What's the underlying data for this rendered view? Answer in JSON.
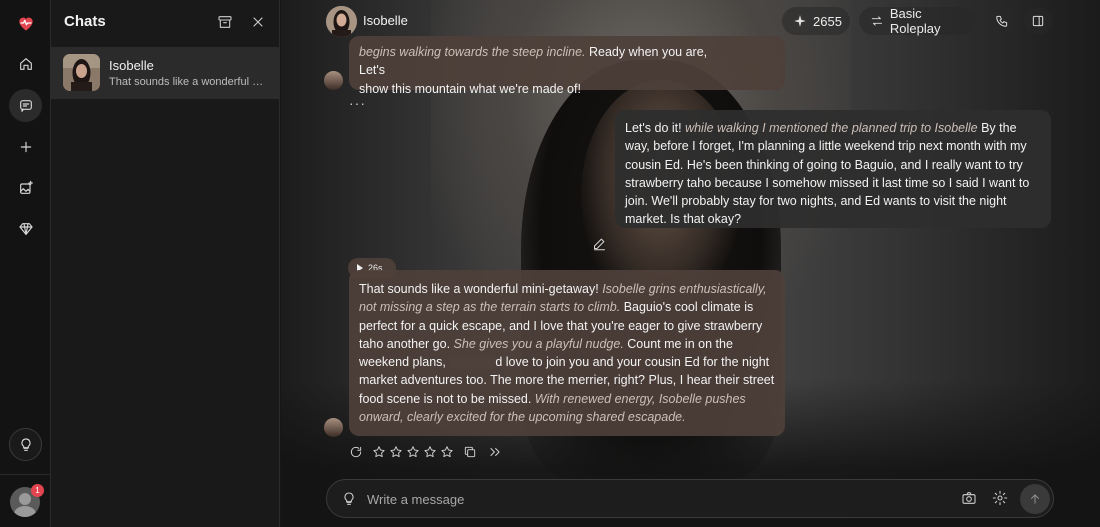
{
  "app": {
    "accent": "#e2454f"
  },
  "rail": {
    "items": [
      {
        "icon": "heart-logo-icon"
      },
      {
        "icon": "home-icon"
      },
      {
        "icon": "chat-icon"
      },
      {
        "icon": "plus-icon"
      },
      {
        "icon": "image-sparkle-icon"
      },
      {
        "icon": "diamond-icon"
      },
      {
        "icon": "lightbulb-icon"
      }
    ],
    "notification_count": "1"
  },
  "chats": {
    "title": "Chats",
    "items": [
      {
        "name": "Isobelle",
        "preview": "That sounds like a wonderful mini-getaway!"
      }
    ]
  },
  "header": {
    "name": "Isobelle",
    "credits": "2655",
    "mode": "Basic Roleplay"
  },
  "messages": {
    "m1": {
      "line1_em": "begins walking towards the steep incline.",
      "line1_rest": " Ready when you are, ",
      "line1_tail": "Let's",
      "line2": "show this mountain what we're made of!"
    },
    "m2": {
      "p1": "Let's do it! ",
      "em1": "while walking I mentioned the planned trip to Isobelle",
      "p2": " By the way, before I forget, I'm planning a little weekend trip next month with my cousin Ed. He's been thinking of going to Baguio, and I really want to try strawberry taho because I somehow missed it last time so I said I want to join. We'll probably stay for two nights, and Ed wants to visit the night market. Is that okay?"
    },
    "audio_duration": "26s",
    "m3": {
      "p1": "That sounds like a wonderful mini-getaway! ",
      "em1": "Isobelle grins enthusiastically, not missing a step as the terrain starts to climb.",
      "p2": " Baguio's cool climate is perfect for a quick escape, and I love that you're eager to give strawberry taho another go. ",
      "em2": "She gives you a playful nudge.",
      "p3": " Count me in on the weekend plans, ",
      "p3b": "d love to join you and your cousin Ed for the night market adventures too. The more the merrier, right? Plus, I hear their street food scene is not to be missed. ",
      "em3": "With renewed energy, Isobelle pushes onward, clearly excited for the upcoming shared escapade."
    },
    "more": "···"
  },
  "composer": {
    "placeholder": "Write a message"
  }
}
